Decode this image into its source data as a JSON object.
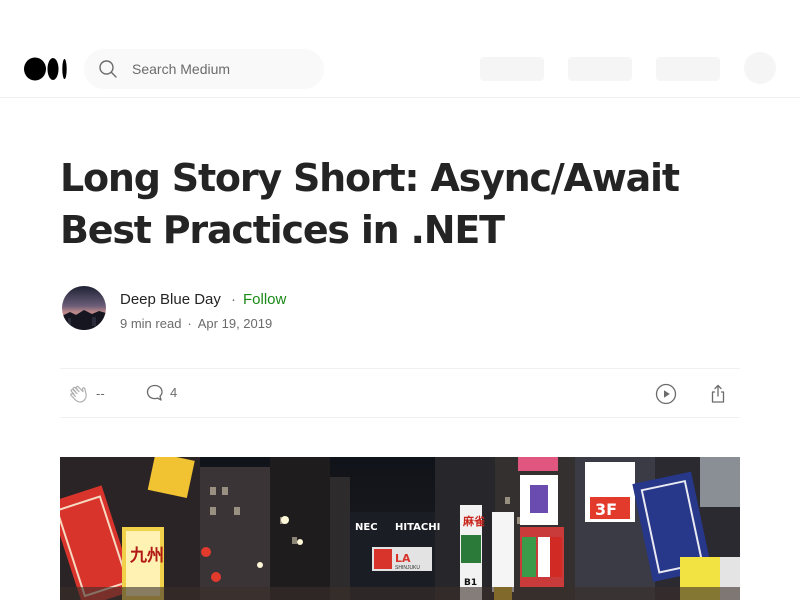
{
  "nav": {
    "search_placeholder": "Search Medium"
  },
  "article": {
    "title": "Long Story Short: Async/Await Best Practices in .NET",
    "author": "Deep Blue Day",
    "follow_label": "Follow",
    "separator": "·",
    "read_time": "9 min read",
    "date": "Apr 19, 2019"
  },
  "actions": {
    "claps": "--",
    "responses": "4"
  },
  "hero_signs": {
    "nec": "NEC",
    "hitachi": "HITACHI",
    "shinjuku": "SHINJUKU",
    "san_f": "3F",
    "b1": "B1",
    "kanji_left": "九州",
    "kanji_mid": "麻雀"
  },
  "colors": {
    "accent_follow": "#1a8917",
    "text_primary": "#242424",
    "text_secondary": "#6b6b6b"
  },
  "icons": [
    "medium-logo-icon",
    "search-icon",
    "clap-icon",
    "response-icon",
    "listen-icon",
    "share-icon"
  ]
}
